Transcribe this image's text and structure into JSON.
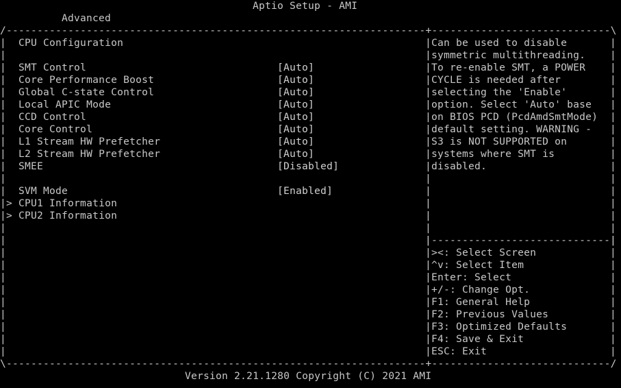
{
  "window": {
    "title": "Aptio Setup - AMI"
  },
  "tabs": [
    {
      "label": "Advanced",
      "active": true
    }
  ],
  "main": {
    "section_title": "CPU Configuration",
    "settings": [
      {
        "label": "SMT Control",
        "value": "[Auto]"
      },
      {
        "label": "Core Performance Boost",
        "value": "[Auto]"
      },
      {
        "label": "Global C-state Control",
        "value": "[Auto]"
      },
      {
        "label": "Local APIC Mode",
        "value": "[Auto]"
      },
      {
        "label": "CCD Control",
        "value": "[Auto]"
      },
      {
        "label": "Core Control",
        "value": "[Auto]"
      },
      {
        "label": "L1 Stream HW Prefetcher",
        "value": "[Auto]"
      },
      {
        "label": "L2 Stream HW Prefetcher",
        "value": "[Auto]"
      },
      {
        "label": "SMEE",
        "value": "[Disabled]"
      },
      {
        "label": "SVM Mode",
        "value": "[Enabled]"
      }
    ],
    "submenus": [
      {
        "marker": ">",
        "label": "CPU1 Information"
      },
      {
        "marker": ">",
        "label": "CPU2 Information"
      }
    ]
  },
  "help": {
    "lines": [
      "Can be used to disable",
      "symmetric multithreading.",
      "To re-enable SMT, a POWER",
      "CYCLE is needed after",
      "selecting the 'Enable'",
      "option. Select 'Auto' base",
      "on BIOS PCD (PcdAmdSmtMode)",
      "default setting. WARNING -",
      "S3 is NOT SUPPORTED on",
      "systems where SMT is",
      "disabled."
    ]
  },
  "keys": [
    "><: Select Screen",
    "^v: Select Item",
    "Enter: Select",
    "+/-: Change Opt.",
    "F1: General Help",
    "F2: Previous Values",
    "F3: Optimized Defaults",
    "F4: Save & Exit",
    "ESC: Exit"
  ],
  "footer": {
    "version": "Version 2.21.1280 Copyright (C) 2021 AMI"
  }
}
